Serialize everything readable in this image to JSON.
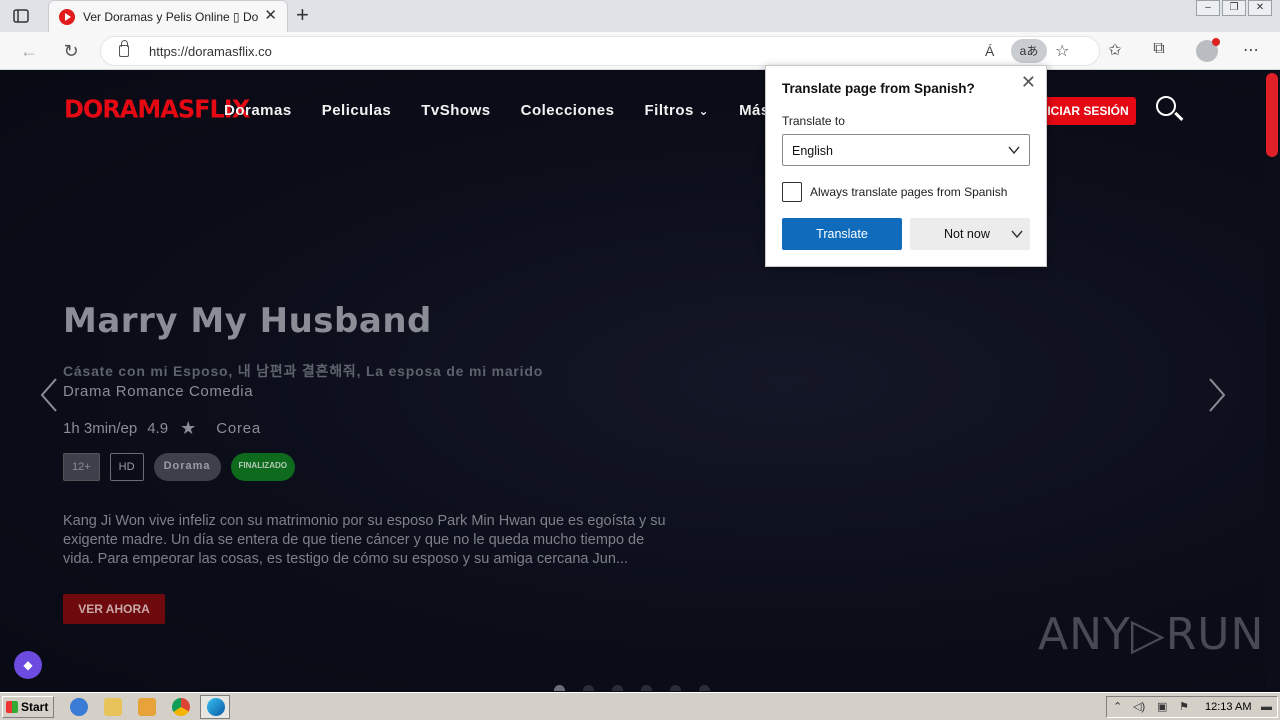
{
  "browser": {
    "tab_title": "Ver Doramas y Pelis Online ▯ Doramas",
    "url": "https://doramasflix.co",
    "translate_icon_label": "aあ",
    "readaloud_label": "Á"
  },
  "site": {
    "logo": "DORAMASFLIX",
    "nav": [
      "Doramas",
      "Peliculas",
      "TvShows",
      "Colecciones",
      "Filtros",
      "Más"
    ],
    "login_label": "INICIAR SESIÓN"
  },
  "hero": {
    "title": "Marry My Husband",
    "alt_titles": "Cásate con mi Esposo, 내 남편과 결혼해줘, La esposa de mi marido",
    "genres": "Drama  Romance  Comedia",
    "duration": "1h 3min/ep",
    "rating": "4.9",
    "country": "Corea",
    "badges": {
      "age": "12+",
      "quality": "HD",
      "type": "Dorama",
      "status": "FINALIZADO"
    },
    "synopsis": "Kang Ji Won vive infeliz con su matrimonio por su esposo Park Min Hwan que es egoísta y su exigente madre. Un día se entera de que tiene cáncer y que no le queda mucho tiempo de vida. Para empeorar las cosas, es testigo de cómo su esposo y su amiga cercana Jun...",
    "cta_label": "VER AHORA",
    "slide_count": 6,
    "active_slide": 1
  },
  "translate_popup": {
    "title": "Translate page from Spanish?",
    "translate_to_label": "Translate to",
    "selected_language": "English",
    "always_label": "Always translate pages from Spanish",
    "always_checked": false,
    "translate_button": "Translate",
    "not_now_button": "Not now"
  },
  "watermark": "ANY▷RUN",
  "taskbar": {
    "start_label": "Start",
    "clock": "12:13 AM"
  },
  "colors": {
    "brand_red": "#e50914",
    "primary_blue": "#0f6cbd",
    "status_green": "#0e6b1d"
  }
}
